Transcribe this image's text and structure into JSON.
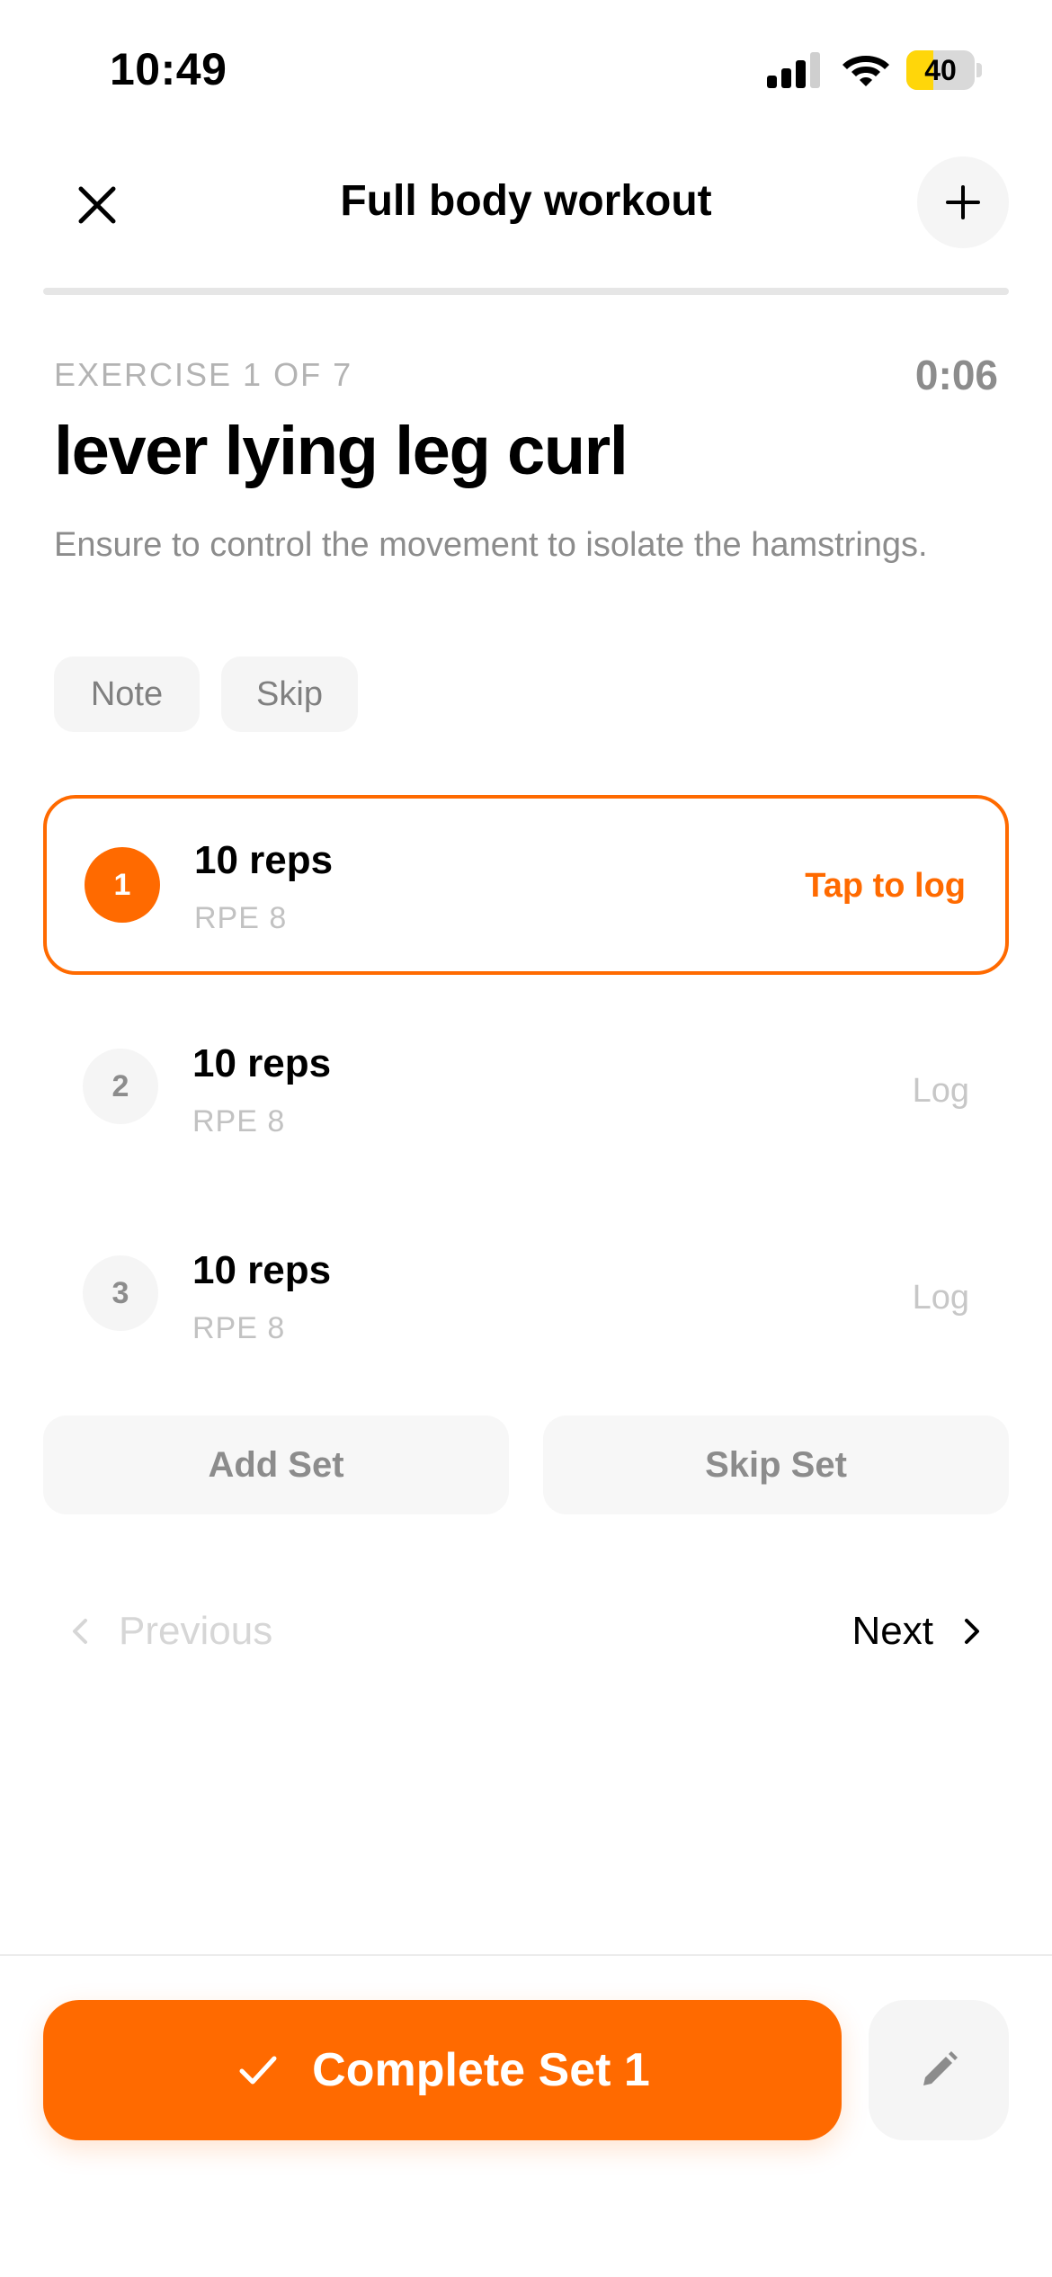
{
  "status_bar": {
    "time": "10:49",
    "battery": "40",
    "battery_level": 0.4
  },
  "header": {
    "title": "Full body workout",
    "progress": 0
  },
  "exercise": {
    "counter": "EXERCISE 1 OF 7",
    "timer": "0:06",
    "name": "lever lying leg curl",
    "description": "Ensure to control the movement to isolate the hamstrings.",
    "chips": {
      "note": "Note",
      "skip": "Skip"
    }
  },
  "sets": [
    {
      "number": "1",
      "reps": "10 reps",
      "rpe": "RPE 8",
      "action": "Tap to log"
    },
    {
      "number": "2",
      "reps": "10 reps",
      "rpe": "RPE 8",
      "action": "Log"
    },
    {
      "number": "3",
      "reps": "10 reps",
      "rpe": "RPE 8",
      "action": "Log"
    }
  ],
  "set_actions": {
    "add": "Add Set",
    "skip": "Skip Set"
  },
  "navigation": {
    "previous": "Previous",
    "next": "Next"
  },
  "footer": {
    "complete_label": "Complete Set 1"
  },
  "colors": {
    "accent": "#ff6a00",
    "battery": "#ffd60a"
  }
}
